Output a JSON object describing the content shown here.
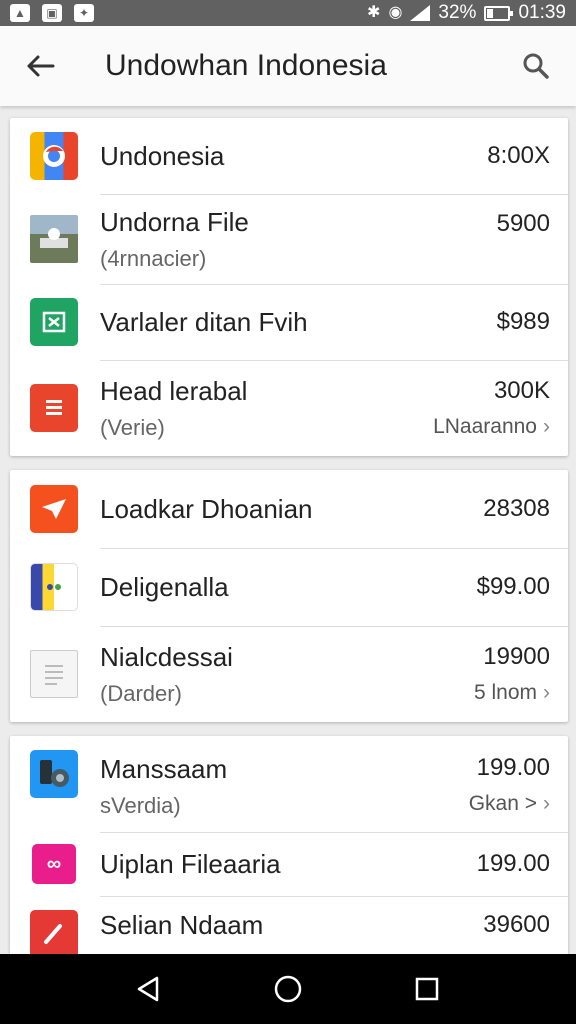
{
  "status_bar": {
    "battery_percent_text": "32%",
    "battery_level": 0.32,
    "time": "01:39",
    "left_icons": [
      "image-icon",
      "photo-icon",
      "notification-icon"
    ],
    "right_icons": [
      "bluetooth-icon",
      "wifi-icon",
      "signal-icon",
      "battery-icon"
    ]
  },
  "app_bar": {
    "title": "Undowhan Indonesia",
    "back_icon": "arrow-back-icon",
    "search_icon": "search-icon"
  },
  "cards": [
    {
      "rows": [
        {
          "title": "Undonesia",
          "subtitle": "",
          "value": "8:00X",
          "detail": "",
          "icon": "folder-chrome-icon",
          "icon_color": "#f4b400"
        },
        {
          "title": "Undorna File",
          "subtitle": "(4rnnacier)",
          "value": "5900",
          "detail": "",
          "icon": "photo-thumbnail-icon",
          "icon_color": "#6d7b5a"
        },
        {
          "title": "Varlaler ditan Fvih",
          "subtitle": "",
          "value": "$989",
          "detail": "",
          "icon": "sheet-icon",
          "icon_color": "#1fa463"
        },
        {
          "title": "Head lerabal",
          "subtitle": "(Verie)",
          "value": "300K",
          "detail": "LNaaranno",
          "icon": "document-list-icon",
          "icon_color": "#e8452c"
        }
      ]
    },
    {
      "rows": [
        {
          "title": "Loadkar Dhoanian",
          "subtitle": "",
          "value": "28308",
          "detail": "",
          "icon": "paper-plane-icon",
          "icon_color": "#f4511e"
        },
        {
          "title": "Deligenalla",
          "subtitle": "",
          "value": "$99.00",
          "detail": "",
          "icon": "multi-color-app-icon",
          "icon_color": "#3949ab"
        },
        {
          "title": "Nialcdessai",
          "subtitle": "(Darder)",
          "value": "19900",
          "detail": "5 lnom",
          "icon": "blank-document-icon",
          "icon_color": "#f5f5f5"
        }
      ]
    },
    {
      "rows": [
        {
          "title": "Manssaam",
          "subtitle": "sVerdia)",
          "value": "199.00",
          "detail": "Gkan >",
          "icon": "phone-settings-icon",
          "icon_color": "#2196f3"
        },
        {
          "title": "Uiplan Fileaaria",
          "subtitle": "",
          "value": "199.00",
          "detail": "",
          "icon": "infinity-app-icon",
          "icon_color": "#e91e8c"
        },
        {
          "title": "Selian Ndaam",
          "subtitle": "",
          "value": "39600",
          "detail": "",
          "icon": "brush-app-icon",
          "icon_color": "#e53935"
        }
      ]
    }
  ],
  "nav_bar": {
    "back": "nav-back-icon",
    "home": "nav-home-icon",
    "recents": "nav-recents-icon"
  }
}
